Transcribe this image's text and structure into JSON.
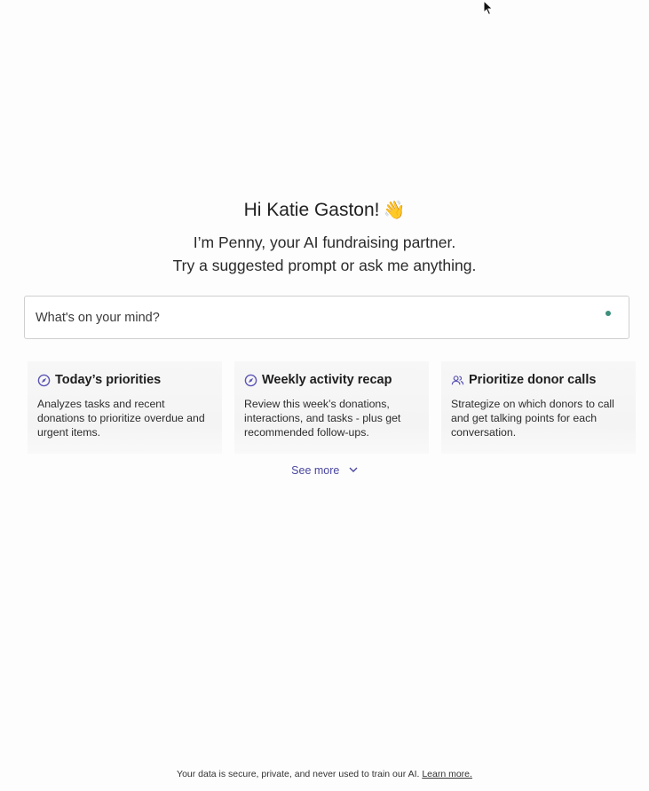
{
  "greeting": {
    "text": "Hi Katie Gaston!",
    "emoji": "👋"
  },
  "subtitle": {
    "line1": "I’m Penny, your AI fundraising partner.",
    "line2": "Try a suggested prompt or ask me anything."
  },
  "prompt": {
    "placeholder": "What's on your mind?",
    "value": ""
  },
  "cards": [
    {
      "icon": "compass-icon",
      "title": "Today’s priorities",
      "description": "Analyzes tasks and recent donations to prioritize overdue and urgent items."
    },
    {
      "icon": "compass-icon",
      "title": "Weekly activity recap",
      "description": "Review this week’s donations, interactions, and tasks - plus get recommended follow-ups."
    },
    {
      "icon": "people-icon",
      "title": "Prioritize donor calls",
      "description": "Strategize on which donors to call and get talking points for each conversation."
    }
  ],
  "see_more": {
    "label": "See more"
  },
  "footer": {
    "text": "Your data is secure, private, and never used to train our AI.",
    "link_label": "Learn more."
  },
  "colors": {
    "accent": "#4a47a0",
    "status_dot": "#3d8f7c",
    "icon": "#5b55b5"
  }
}
